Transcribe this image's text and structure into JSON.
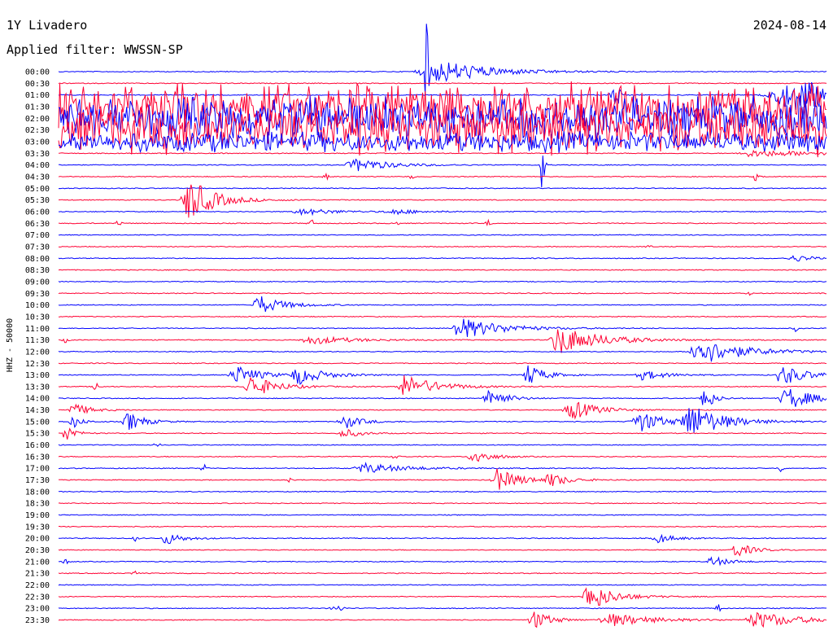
{
  "header": {
    "station": "1Y Livadero",
    "date": "2024-08-14",
    "filter": "Applied filter: WWSSN-SP"
  },
  "chart_data": {
    "type": "helicorder",
    "ylabel": "HHZ - 50000",
    "colors": [
      "#0000ff",
      "#ff0033"
    ],
    "rows": [
      {
        "t": "00:00",
        "events": [
          [
            0.5,
            0.04,
            14,
            0.06,
            0
          ],
          [
            0.48,
            0.004,
            70,
            0,
            0
          ]
        ]
      },
      {
        "t": "00:30",
        "events": []
      },
      {
        "t": "01:00",
        "events": [
          [
            0.73,
            0.015,
            18,
            0,
            0
          ],
          [
            0.96,
            0.05,
            20,
            0.1,
            0
          ]
        ]
      },
      {
        "t": "01:30",
        "events": [],
        "noise": 32
      },
      {
        "t": "02:00",
        "events": [],
        "noise": 30
      },
      {
        "t": "02:30",
        "events": [],
        "noise": 34
      },
      {
        "t": "03:00",
        "events": [],
        "noise": 14
      },
      {
        "t": "03:30",
        "events": [
          [
            0.9,
            0.02,
            4,
            0.1,
            0
          ]
        ]
      },
      {
        "t": "04:00",
        "events": [
          [
            0.39,
            0.02,
            8,
            0.04,
            0
          ],
          [
            0.63,
            0.003,
            45,
            0,
            0
          ]
        ]
      },
      {
        "t": "04:30",
        "events": [
          [
            0.35,
            0.008,
            4,
            0,
            0
          ],
          [
            0.46,
            0.006,
            3,
            0,
            0
          ],
          [
            0.91,
            0.01,
            6,
            0,
            0
          ]
        ]
      },
      {
        "t": "05:00",
        "events": []
      },
      {
        "t": "05:30",
        "events": [
          [
            0.17,
            0.012,
            28,
            0.03,
            0
          ]
        ]
      },
      {
        "t": "06:00",
        "events": [
          [
            0.32,
            0.02,
            4,
            0.04,
            0
          ],
          [
            0.44,
            0.02,
            3,
            0.03,
            0
          ]
        ]
      },
      {
        "t": "06:30",
        "events": [
          [
            0.08,
            0.01,
            4,
            0,
            0
          ],
          [
            0.33,
            0.008,
            5,
            0,
            0
          ],
          [
            0.44,
            0.01,
            3,
            0,
            0
          ],
          [
            0.56,
            0.006,
            4,
            0,
            0
          ]
        ]
      },
      {
        "t": "07:00",
        "events": []
      },
      {
        "t": "07:30",
        "events": [
          [
            0.77,
            0.008,
            2,
            0,
            0
          ]
        ]
      },
      {
        "t": "08:00",
        "events": [
          [
            0.96,
            0.015,
            4,
            0.02,
            0
          ]
        ]
      },
      {
        "t": "08:30",
        "events": []
      },
      {
        "t": "09:00",
        "events": []
      },
      {
        "t": "09:30",
        "events": [
          [
            0.9,
            0.008,
            2,
            0,
            0
          ]
        ]
      },
      {
        "t": "10:00",
        "events": [
          [
            0.26,
            0.01,
            12,
            0.03,
            0
          ]
        ]
      },
      {
        "t": "10:30",
        "events": []
      },
      {
        "t": "11:00",
        "events": [
          [
            0.52,
            0.01,
            14,
            0.05,
            0
          ],
          [
            0.96,
            0.006,
            4,
            0,
            0
          ]
        ]
      },
      {
        "t": "11:30",
        "events": [
          [
            0.01,
            0.006,
            4,
            0,
            0
          ],
          [
            0.33,
            0.02,
            5,
            0.05,
            0
          ],
          [
            0.65,
            0.012,
            18,
            0.05,
            0
          ]
        ]
      },
      {
        "t": "12:00",
        "events": [
          [
            0.83,
            0.01,
            18,
            0.05,
            0
          ]
        ]
      },
      {
        "t": "12:30",
        "events": []
      },
      {
        "t": "13:00",
        "events": [
          [
            0.23,
            0.01,
            12,
            0.03,
            0
          ],
          [
            0.31,
            0.008,
            12,
            0.03,
            0
          ],
          [
            0.61,
            0.006,
            14,
            0.02,
            0
          ],
          [
            0.76,
            0.01,
            6,
            0.03,
            0
          ],
          [
            0.94,
            0.006,
            14,
            0.03,
            0
          ]
        ]
      },
      {
        "t": "13:30",
        "events": [
          [
            0.05,
            0.006,
            8,
            0,
            0
          ],
          [
            0.25,
            0.01,
            14,
            0.03,
            0
          ],
          [
            0.45,
            0.012,
            14,
            0.04,
            0
          ]
        ]
      },
      {
        "t": "14:00",
        "events": [
          [
            0.56,
            0.008,
            14,
            0.02,
            0
          ],
          [
            0.95,
            0.015,
            14,
            0.03,
            0
          ],
          [
            0.84,
            0.005,
            20,
            0.01,
            0
          ]
        ]
      },
      {
        "t": "14:30",
        "events": [
          [
            0.02,
            0.01,
            8,
            0.02,
            0
          ],
          [
            0.67,
            0.015,
            12,
            0.03,
            0
          ]
        ]
      },
      {
        "t": "15:00",
        "events": [
          [
            0.02,
            0.008,
            8,
            0.01,
            0
          ],
          [
            0.09,
            0.008,
            12,
            0.02,
            0
          ],
          [
            0.37,
            0.008,
            10,
            0.02,
            0
          ],
          [
            0.76,
            0.02,
            12,
            0.03,
            0
          ],
          [
            0.82,
            0.01,
            22,
            0.04,
            0
          ]
        ]
      },
      {
        "t": "15:30",
        "events": [
          [
            0.01,
            0.006,
            12,
            0.01,
            0
          ],
          [
            0.37,
            0.008,
            6,
            0.02,
            0
          ]
        ]
      },
      {
        "t": "16:00",
        "events": [
          [
            0.13,
            0.008,
            3,
            0,
            0
          ]
        ]
      },
      {
        "t": "16:30",
        "events": [
          [
            0.44,
            0.006,
            6,
            0,
            0
          ],
          [
            0.54,
            0.008,
            10,
            0.02,
            0
          ]
        ]
      },
      {
        "t": "17:00",
        "events": [
          [
            0.19,
            0.006,
            6,
            0,
            0
          ],
          [
            0.4,
            0.02,
            6,
            0.05,
            0
          ],
          [
            0.94,
            0.005,
            8,
            0,
            0
          ]
        ]
      },
      {
        "t": "17:30",
        "events": [
          [
            0.3,
            0.004,
            4,
            0,
            0
          ],
          [
            0.57,
            0.01,
            14,
            0.03,
            0
          ],
          [
            0.64,
            0.008,
            8,
            0.02,
            0
          ]
        ]
      },
      {
        "t": "18:00",
        "events": []
      },
      {
        "t": "18:30",
        "events": []
      },
      {
        "t": "19:00",
        "events": []
      },
      {
        "t": "19:30",
        "events": []
      },
      {
        "t": "20:00",
        "events": [
          [
            0.1,
            0.005,
            4,
            0,
            0
          ],
          [
            0.14,
            0.008,
            8,
            0.02,
            0
          ],
          [
            0.78,
            0.008,
            6,
            0.02,
            0
          ]
        ]
      },
      {
        "t": "20:30",
        "events": [
          [
            0.88,
            0.006,
            10,
            0.02,
            0
          ]
        ]
      },
      {
        "t": "21:00",
        "events": [
          [
            0.01,
            0.006,
            4,
            0,
            0
          ],
          [
            0.85,
            0.006,
            7,
            0.02,
            0
          ]
        ]
      },
      {
        "t": "21:30",
        "events": [
          [
            0.1,
            0.008,
            4,
            0,
            0
          ]
        ]
      },
      {
        "t": "22:00",
        "events": []
      },
      {
        "t": "22:30",
        "events": [
          [
            0.69,
            0.01,
            18,
            0.03,
            0
          ]
        ]
      },
      {
        "t": "23:00",
        "events": [
          [
            0.37,
            0.02,
            4,
            0,
            0
          ],
          [
            0.86,
            0.006,
            6,
            0,
            0
          ]
        ]
      },
      {
        "t": "23:30",
        "events": [
          [
            0.62,
            0.01,
            12,
            0.02,
            0
          ],
          [
            0.72,
            0.02,
            8,
            0.05,
            0
          ],
          [
            0.91,
            0.02,
            10,
            0.05,
            0
          ]
        ]
      }
    ]
  }
}
